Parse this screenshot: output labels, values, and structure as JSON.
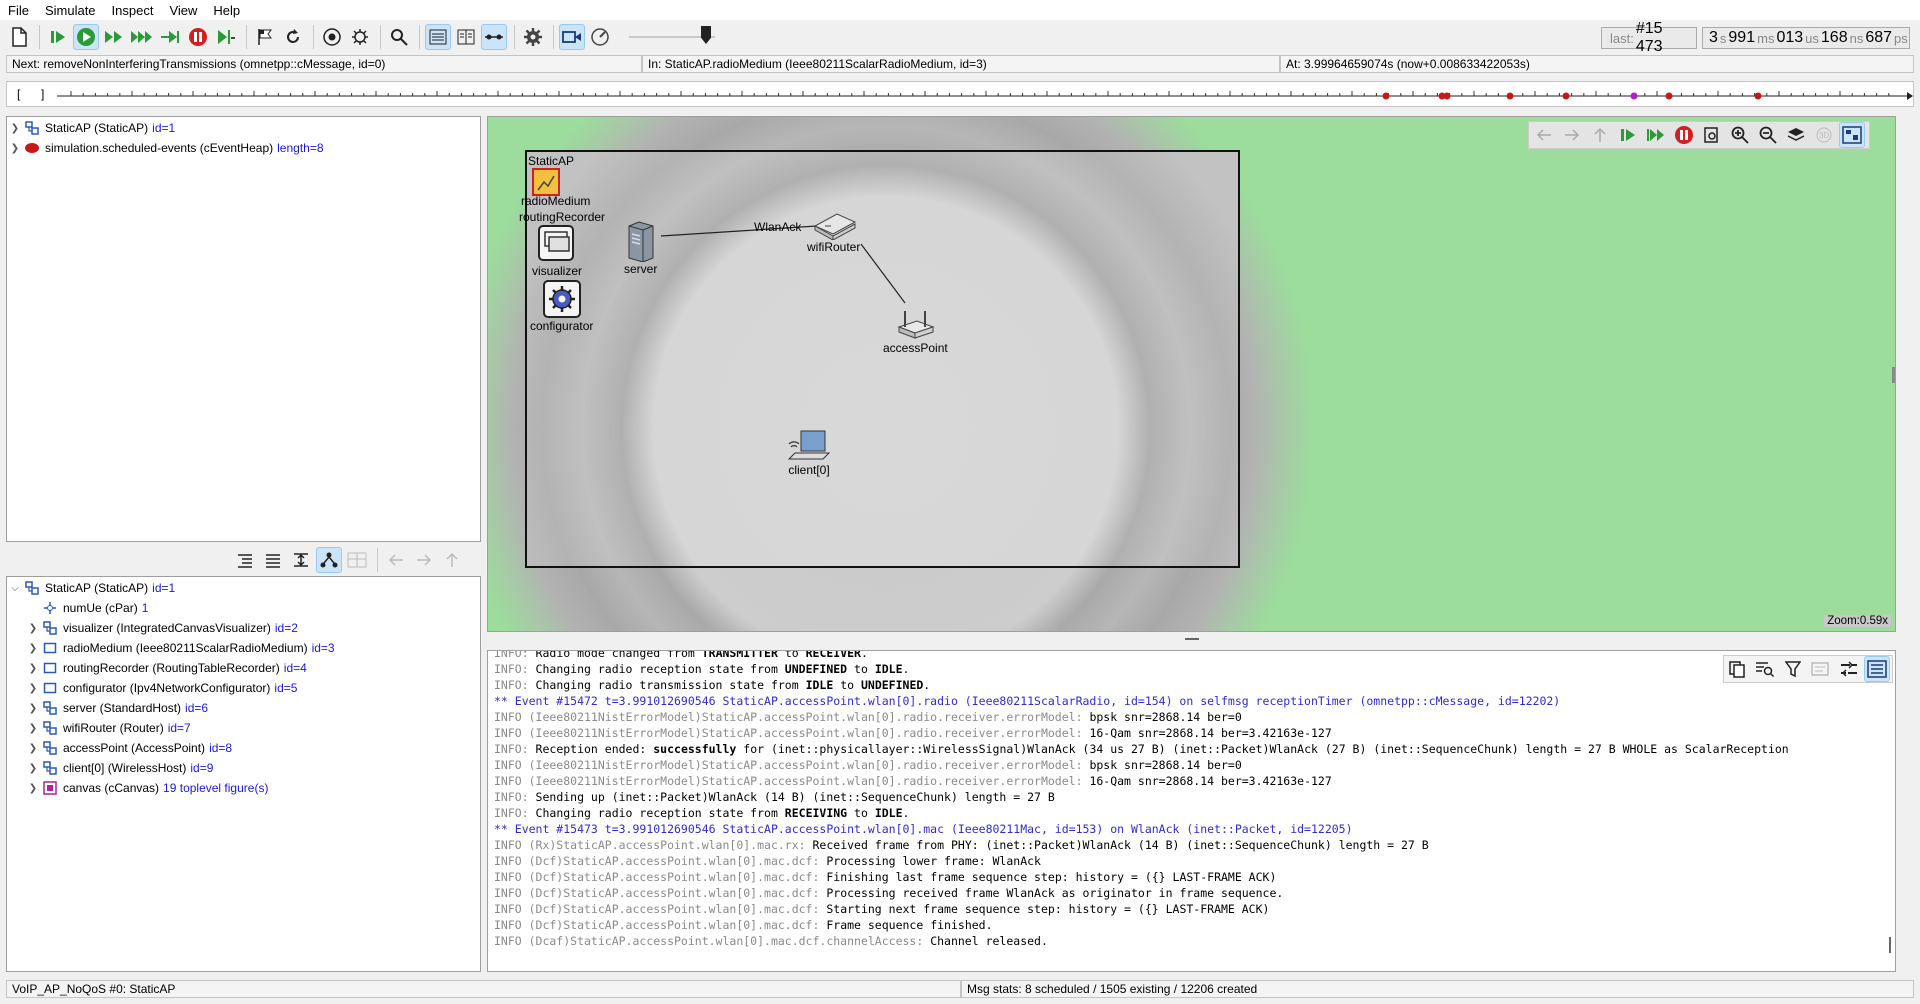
{
  "menu": [
    "File",
    "Simulate",
    "Inspect",
    "View",
    "Help"
  ],
  "toolbar": {
    "buttons": [
      "new-icon",
      "step-icon",
      "run-icon",
      "fast-run-icon",
      "express-run-icon",
      "run-until-icon",
      "stop-icon",
      "run-local-icon",
      "bookmark-icon",
      "rebuild-icon",
      "record-icon",
      "debug-icon",
      "find-icon",
      "layout-horizontal-icon",
      "layout-vertical-icon",
      "timeline-icon",
      "settings-icon",
      "video-icon",
      "animation-speed-icon"
    ]
  },
  "counters": {
    "last_label": "last:",
    "last_value": "#15 473",
    "time_s": "3",
    "time_ms": "991",
    "time_us": "013",
    "time_ns": "168",
    "time_ps": "687",
    "unit_s": "s",
    "unit_ms": "ms",
    "unit_us": "us",
    "unit_ns": "ns",
    "unit_ps": "ps"
  },
  "info": {
    "next": "Next: removeNonInterferingTransmissions (omnetpp::cMessage, id=0)",
    "in": "In: StaticAP.radioMedium (Ieee80211ScalarRadioMedium, id=3)",
    "at": "At: 3.99964659074s (now+0.008633422053s)"
  },
  "timeline": {
    "left_bracket": "[",
    "right_bracket": "]"
  },
  "object_tree": [
    {
      "name": "StaticAP (StaticAP)",
      "id": "id=1",
      "icon": "module-icon"
    },
    {
      "name": "simulation.scheduled-events (cEventHeap)",
      "id": "length=8",
      "icon": "event-heap-icon"
    }
  ],
  "module_tree": {
    "root": {
      "name": "StaticAP (StaticAP)",
      "id": "id=1"
    },
    "children": [
      {
        "name": "numUe (cPar)",
        "id": "1",
        "icon": "param-icon",
        "expandable": false
      },
      {
        "name": "visualizer (IntegratedCanvasVisualizer)",
        "id": "id=2",
        "icon": "module-icon",
        "expandable": true
      },
      {
        "name": "radioMedium (Ieee80211ScalarRadioMedium)",
        "id": "id=3",
        "icon": "simple-module-icon",
        "expandable": true
      },
      {
        "name": "routingRecorder (RoutingTableRecorder)",
        "id": "id=4",
        "icon": "simple-module-icon",
        "expandable": true
      },
      {
        "name": "configurator (Ipv4NetworkConfigurator)",
        "id": "id=5",
        "icon": "simple-module-icon",
        "expandable": true
      },
      {
        "name": "server (StandardHost)",
        "id": "id=6",
        "icon": "module-icon",
        "expandable": true
      },
      {
        "name": "wifiRouter (Router)",
        "id": "id=7",
        "icon": "module-icon",
        "expandable": true
      },
      {
        "name": "accessPoint (AccessPoint)",
        "id": "id=8",
        "icon": "module-icon",
        "expandable": true
      },
      {
        "name": "client[0] (WirelessHost)",
        "id": "id=9",
        "icon": "module-icon",
        "expandable": true
      },
      {
        "name": "canvas (cCanvas)",
        "id": "19 toplevel figure(s)",
        "icon": "canvas-icon",
        "expandable": true
      }
    ]
  },
  "network": {
    "title": "StaticAP",
    "zoom": "Zoom:0.59x",
    "nodes": {
      "radioMedium": "radioMedium",
      "routingRecorder": "routingRecorder",
      "visualizer": "visualizer",
      "configurator": "configurator",
      "server": "server",
      "wifiRouter": "wifiRouter",
      "accessPoint": "accessPoint",
      "client": "client[0]"
    },
    "message_label": "WlanAck"
  },
  "log": [
    {
      "type": "info",
      "prefix": "INFO: ",
      "text": "Radio mode changed from ",
      "b1": "TRANSMITTER",
      "mid": " to ",
      "b2": "RECEIVER",
      "end": "."
    },
    {
      "type": "info",
      "prefix": "INFO: ",
      "text": "Changing radio reception state from ",
      "b1": "UNDEFINED",
      "mid": " to ",
      "b2": "IDLE",
      "end": "."
    },
    {
      "type": "info",
      "prefix": "INFO: ",
      "text": "Changing radio transmission state from ",
      "b1": "IDLE",
      "mid": " to ",
      "b2": "UNDEFINED",
      "end": "."
    },
    {
      "type": "event",
      "text": "** Event #15472  t=3.991012690546  StaticAP.accessPoint.wlan[0].radio (Ieee80211ScalarRadio, id=154)  on selfmsg receptionTimer (omnetpp::cMessage, id=12202)"
    },
    {
      "type": "ctx",
      "prefix": "INFO (Ieee80211NistErrorModel)StaticAP.accessPoint.wlan[0].radio.receiver.errorModel: ",
      "text": "bpsk snr=2868.14 ber=0"
    },
    {
      "type": "ctx",
      "prefix": "INFO (Ieee80211NistErrorModel)StaticAP.accessPoint.wlan[0].radio.receiver.errorModel: ",
      "text": "16-Qam snr=2868.14 ber=3.42163e-127"
    },
    {
      "type": "recv",
      "prefix": "INFO: ",
      "text": "Reception ended: ",
      "b1": "successfully",
      "end": " for (inet::physicallayer::WirelessSignal)WlanAck (34 us 27 B) (inet::Packet)WlanAck (27 B) (inet::SequenceChunk) length = 27 B WHOLE as ScalarReception"
    },
    {
      "type": "ctx",
      "prefix": "INFO (Ieee80211NistErrorModel)StaticAP.accessPoint.wlan[0].radio.receiver.errorModel: ",
      "text": "bpsk snr=2868.14 ber=0"
    },
    {
      "type": "ctx",
      "prefix": "INFO (Ieee80211NistErrorModel)StaticAP.accessPoint.wlan[0].radio.receiver.errorModel: ",
      "text": "16-Qam snr=2868.14 ber=3.42163e-127"
    },
    {
      "type": "plain",
      "prefix": "INFO: ",
      "text": "Sending up (inet::Packet)WlanAck (14 B) (inet::SequenceChunk) length = 27 B"
    },
    {
      "type": "info",
      "prefix": "INFO: ",
      "text": "Changing radio reception state from ",
      "b1": "RECEIVING",
      "mid": " to ",
      "b2": "IDLE",
      "end": "."
    },
    {
      "type": "event",
      "text": "** Event #15473  t=3.991012690546  StaticAP.accessPoint.wlan[0].mac (Ieee80211Mac, id=153)  on WlanAck (inet::Packet, id=12205)"
    },
    {
      "type": "ctx",
      "prefix": "INFO (Rx)StaticAP.accessPoint.wlan[0].mac.rx: ",
      "text": "Received frame from PHY: (inet::Packet)WlanAck (14 B) (inet::SequenceChunk) length = 27 B"
    },
    {
      "type": "ctx",
      "prefix": "INFO (Dcf)StaticAP.accessPoint.wlan[0].mac.dcf: ",
      "text": "Processing lower frame: WlanAck"
    },
    {
      "type": "ctx",
      "prefix": "INFO (Dcf)StaticAP.accessPoint.wlan[0].mac.dcf: ",
      "text": "Finishing last frame sequence step: history = ({} LAST-FRAME ACK)"
    },
    {
      "type": "ctx",
      "prefix": "INFO (Dcf)StaticAP.accessPoint.wlan[0].mac.dcf: ",
      "text": "Processing received frame WlanAck as originator in frame sequence."
    },
    {
      "type": "ctx",
      "prefix": "INFO (Dcf)StaticAP.accessPoint.wlan[0].mac.dcf: ",
      "text": "Starting next frame sequence step: history = ({} LAST-FRAME ACK)"
    },
    {
      "type": "ctx",
      "prefix": "INFO (Dcf)StaticAP.accessPoint.wlan[0].mac.dcf: ",
      "text": "Frame sequence finished."
    },
    {
      "type": "ctx",
      "prefix": "INFO (Dcaf)StaticAP.accessPoint.wlan[0].mac.dcf.channelAccess: ",
      "text": "Channel released."
    }
  ],
  "status": {
    "left": "VoIP_AP_NoQoS #0: StaticAP",
    "right": "Msg stats: 8 scheduled / 1505 existing / 12206 created"
  },
  "colors": {
    "canvas_bg": "#9cdc9c",
    "network_bg": "#c8c8c8",
    "event_line": "#2c2cd0",
    "id_text": "#1a1ad8",
    "stop_red": "#d22020",
    "run_green": "#2a9a3a"
  }
}
